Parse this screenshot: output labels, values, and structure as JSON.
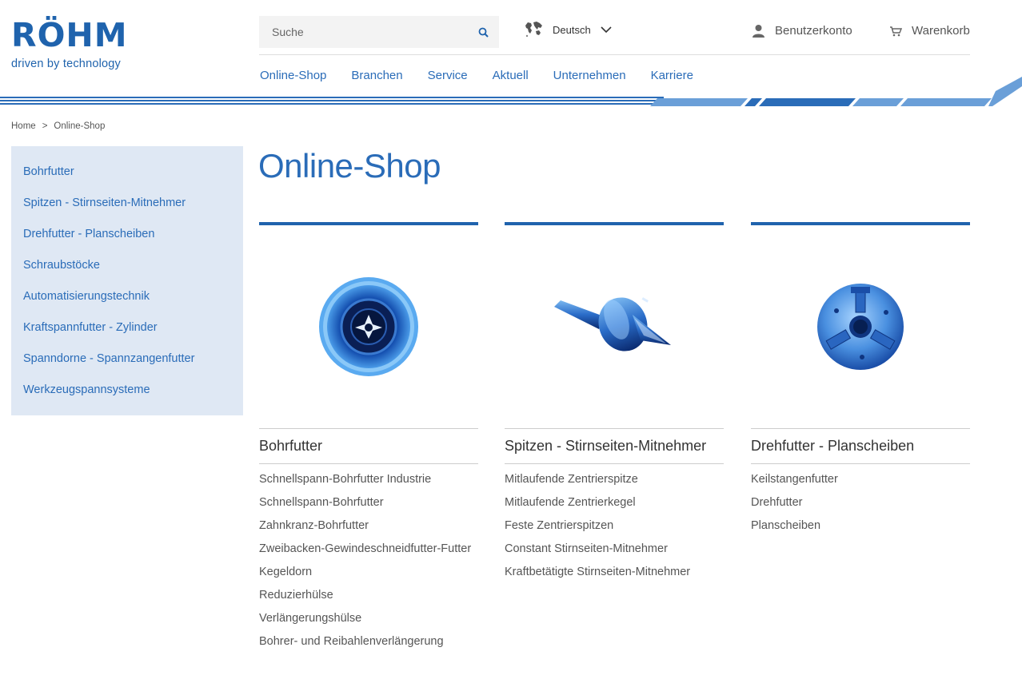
{
  "brand": {
    "logo_text": "RÖHM",
    "tagline": "driven by technology",
    "color_primary": "#1f63ad",
    "color_link": "#2a6cb8"
  },
  "header": {
    "search_placeholder": "Suche",
    "language": "Deutsch",
    "account_label": "Benutzerkonto",
    "cart_label": "Warenkorb"
  },
  "nav": {
    "items": [
      "Online-Shop",
      "Branchen",
      "Service",
      "Aktuell",
      "Unternehmen",
      "Karriere"
    ]
  },
  "breadcrumb": {
    "home": "Home",
    "separator": ">",
    "current": "Online-Shop"
  },
  "sidebar": {
    "items": [
      "Bohrfutter",
      "Spitzen - Stirnseiten-Mitnehmer",
      "Drehfutter - Planscheiben",
      "Schraubstöcke",
      "Automatisierungstechnik",
      "Kraftspannfutter - Zylinder",
      "Spanndorne - Spannzangenfutter",
      "Werkzeugspannsysteme"
    ]
  },
  "page": {
    "title": "Online-Shop"
  },
  "categories": [
    {
      "title": "Bohrfutter",
      "image_icon": "drill-chuck-icon",
      "links": [
        "Schnellspann-Bohrfutter Industrie",
        "Schnellspann-Bohrfutter",
        "Zahnkranz-Bohrfutter",
        "Zweibacken-Gewindeschneidfutter-Futter",
        "Kegeldorn",
        "Reduzierhülse",
        "Verlängerungshülse",
        "Bohrer- und Reibahlenverlängerung"
      ]
    },
    {
      "title": "Spitzen - Stirnseiten-Mitnehmer",
      "image_icon": "live-center-icon",
      "links": [
        "Mitlaufende Zentrierspitze",
        "Mitlaufende Zentrierkegel",
        "Feste Zentrierspitzen",
        "Constant Stirnseiten-Mitnehmer",
        "Kraftbetätigte Stirnseiten-Mitnehmer"
      ]
    },
    {
      "title": "Drehfutter - Planscheiben",
      "image_icon": "lathe-chuck-icon",
      "links": [
        "Keilstangenfutter",
        "Drehfutter",
        "Planscheiben"
      ]
    }
  ]
}
